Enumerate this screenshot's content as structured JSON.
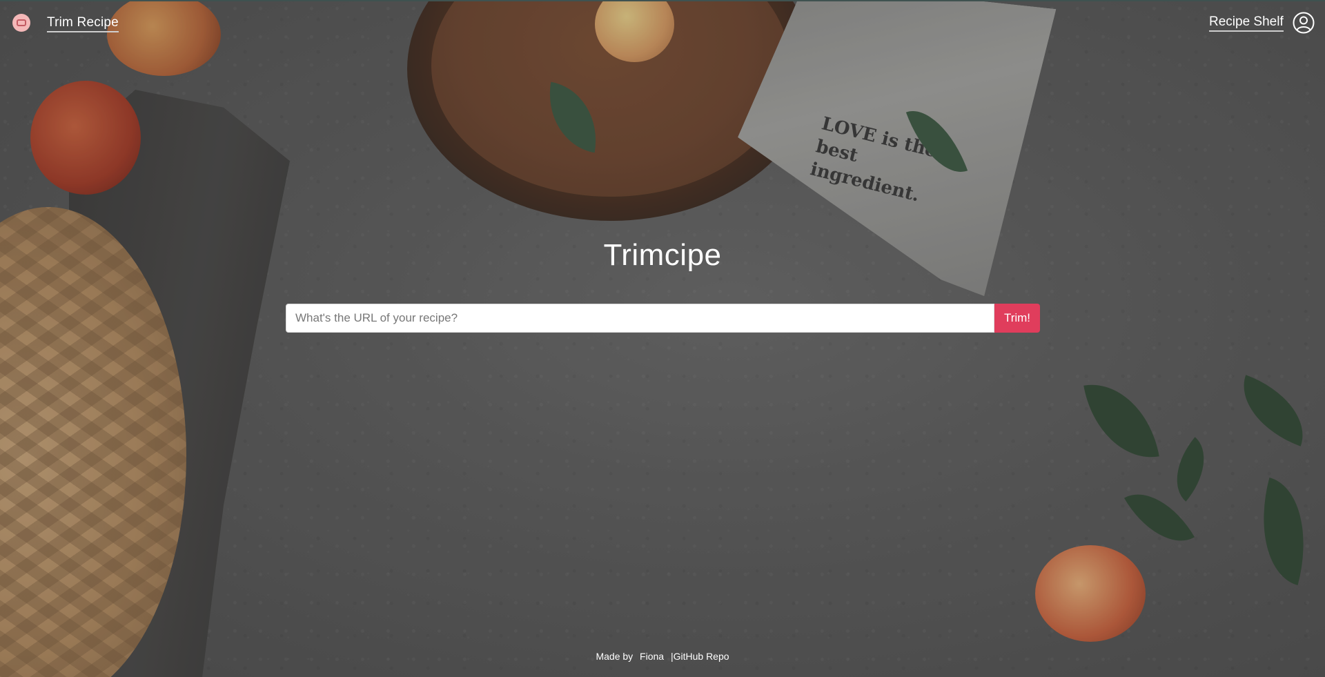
{
  "header": {
    "home_link": "Trim Recipe",
    "shelf_link": "Recipe Shelf",
    "logo_icon": "recipe-logo-icon",
    "account_icon": "user-account-icon"
  },
  "hero": {
    "title": "Trimcipe",
    "search_placeholder": "What's the URL of your recipe?",
    "search_value": "",
    "trim_button": "Trim!"
  },
  "background_text": {
    "napkin": "LOVE is the best ingredient."
  },
  "footer": {
    "made_by": "Made by",
    "author": "Fiona",
    "separator": "|",
    "repo_link": "GitHub Repo"
  },
  "colors": {
    "accent": "#e03d5c",
    "logo_bg": "#f4b8b8",
    "text": "#ffffff"
  }
}
